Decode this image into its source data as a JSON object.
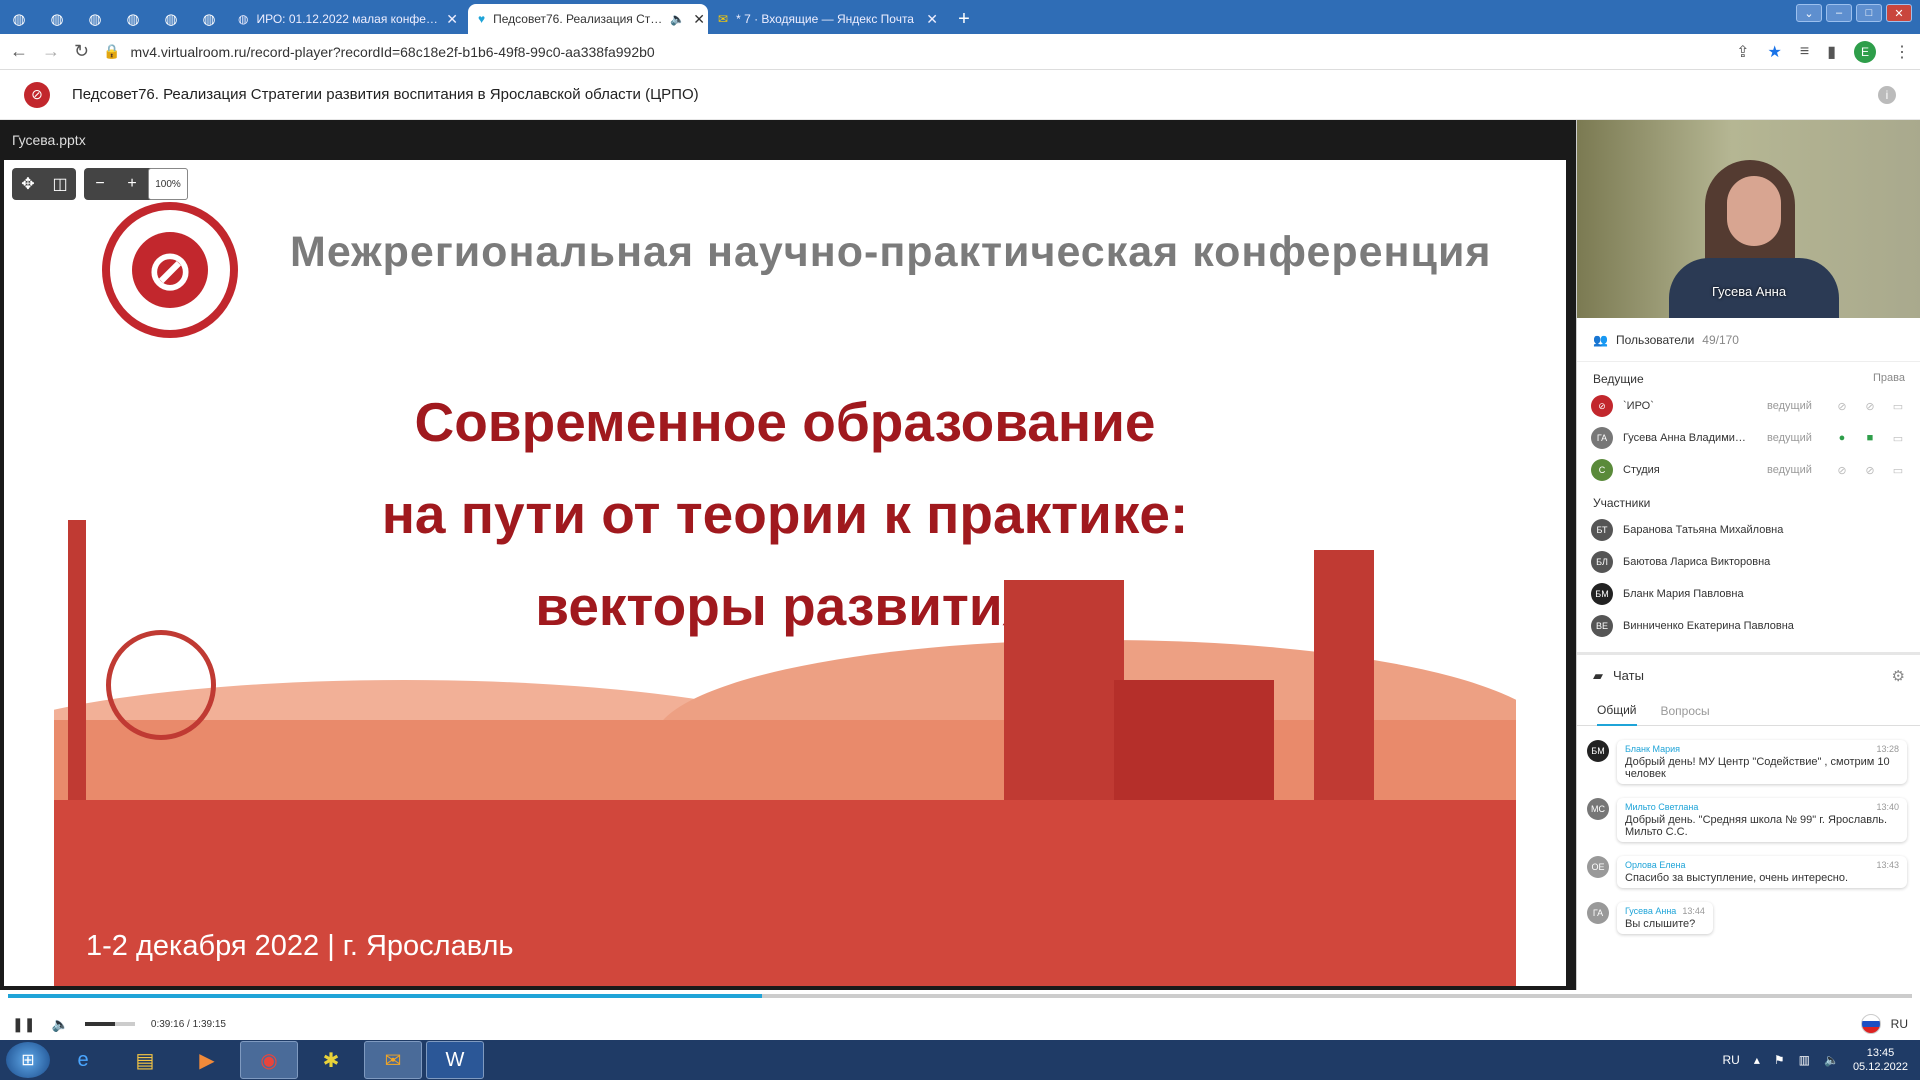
{
  "browser": {
    "tabs": [
      {
        "label": "ИРО: 01.12.2022 малая конфе…"
      },
      {
        "label": "Педсовет76. Реализация Ст…"
      },
      {
        "label": "* 7 · Входящие — Яндекс Почта"
      }
    ],
    "url": "mv4.virtualroom.ru/record-player?recordId=68c18e2f-b1b6-49f8-99c0-aa338fa992b0",
    "profile_initial": "E"
  },
  "app": {
    "title": "Педсовет76. Реализация Стратегии развития воспитания в Ярославской области (ЦРПО)",
    "filename": "Гусева.pptx",
    "zoom": "100%"
  },
  "slide": {
    "conference": "Межрегиональная научно-практическая конференция",
    "line1": "Современное образование",
    "line2": "на пути от теории к практике:",
    "line3": "векторы развития",
    "footer": "1-2 декабря 2022  | г. Ярославль"
  },
  "video": {
    "speaker": "Гусева Анна"
  },
  "users": {
    "title": "Пользователи",
    "count": "49/170",
    "hosts_label": "Ведущие",
    "rights_label": "Права",
    "hosts": [
      {
        "initials": "",
        "name": "`ИРО`",
        "role": "ведущий"
      },
      {
        "initials": "ГА",
        "name": "Гусева Анна Владими…",
        "role": "ведущий"
      },
      {
        "initials": "С",
        "name": "Студия",
        "role": "ведущий"
      }
    ],
    "participants_label": "Участники",
    "participants": [
      {
        "initials": "БТ",
        "name": "Баранова Татьяна Михайловна"
      },
      {
        "initials": "БЛ",
        "name": "Баютова Лариса Викторовна"
      },
      {
        "initials": "БМ",
        "name": "Бланк Мария Павловна"
      },
      {
        "initials": "ВЕ",
        "name": "Винниченко Екатерина Павловна"
      }
    ]
  },
  "chats": {
    "title": "Чаты",
    "tabs": [
      "Общий",
      "Вопросы"
    ],
    "messages": [
      {
        "initials": "БМ",
        "author": "Бланк Мария",
        "time": "13:28",
        "text": "Добрый день! МУ Центр \"Содействие\" , смотрим 10 человек"
      },
      {
        "initials": "МС",
        "author": "Мильто Светлана",
        "time": "13:40",
        "text": "Добрый день. \"Средняя школа № 99\" г. Ярославль. Мильто С.С."
      },
      {
        "initials": "ОЕ",
        "author": "Орлова Елена",
        "time": "13:43",
        "text": "Спасибо за выступление, очень интересно."
      },
      {
        "initials": "ГА",
        "author": "Гусева Анна",
        "time": "13:44",
        "text": "Вы слышите?"
      }
    ]
  },
  "player": {
    "time": "0:39:16 / 1:39:15",
    "progress_pct": 39.6,
    "volume_pct": 60,
    "lang": "RU"
  },
  "taskbar": {
    "lang": "RU",
    "time": "13:45",
    "date": "05.12.2022"
  }
}
